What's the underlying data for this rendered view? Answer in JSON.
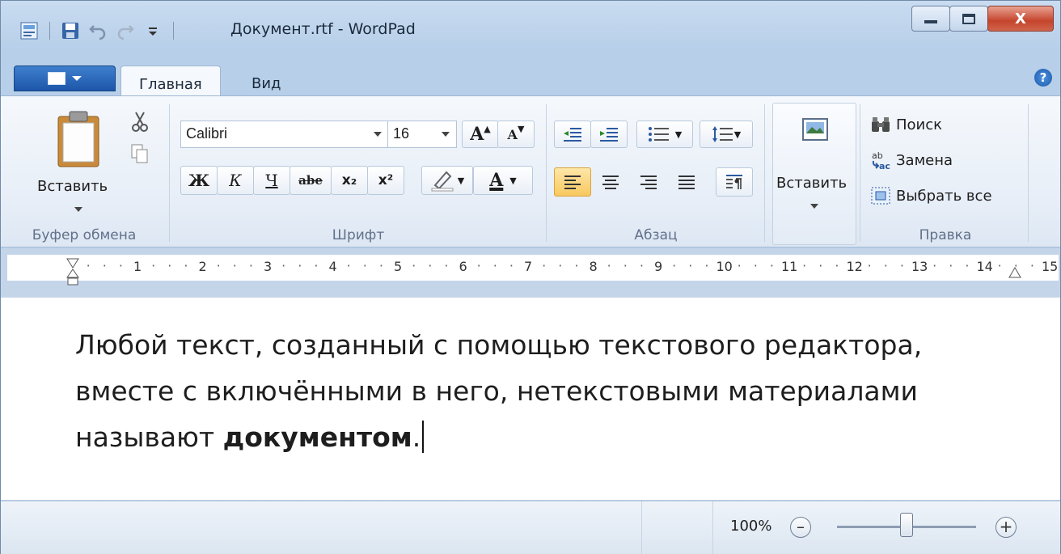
{
  "window": {
    "title": "Документ.rtf - WordPad",
    "close_glyph": "X"
  },
  "tabs": [
    {
      "label": "Главная",
      "active": true
    },
    {
      "label": "Вид",
      "active": false
    }
  ],
  "help_glyph": "?",
  "clipboard": {
    "paste_label": "Вставить",
    "group_label": "Буфер обмена"
  },
  "font": {
    "family_value": "Calibri",
    "size_value": "16",
    "bold_glyph": "Ж",
    "italic_glyph": "К",
    "underline_glyph": "Ч",
    "strike_glyph": "abe",
    "subscript_glyph": "x₂",
    "superscript_glyph": "x²",
    "grow_glyph": "A",
    "shrink_glyph": "A",
    "color_glyph": "A",
    "group_label": "Шрифт"
  },
  "paragraph": {
    "group_label": "Абзац",
    "active_alignment": "left"
  },
  "insert": {
    "label": "Вставить"
  },
  "editing": {
    "find_label": "Поиск",
    "replace_label": "Замена",
    "select_all_label": "Выбрать все",
    "group_label": "Правка"
  },
  "ruler": {
    "numbers": [
      "1",
      "2",
      "3",
      "4",
      "5",
      "6",
      "7",
      "8",
      "9",
      "10",
      "11",
      "12",
      "13",
      "14",
      "15"
    ]
  },
  "document": {
    "line1": "Любой текст, созданный с помощью текстового редактора,",
    "line2": "вместе с включёнными в него, нетекстовыми материалами",
    "line3_prefix": "называют ",
    "line3_bold": "документом",
    "line3_suffix": "."
  },
  "status": {
    "zoom_label": "100%",
    "zoom_fraction": 0.5
  },
  "colors": {
    "accent": "#1d56a8",
    "active_button": "#f8c85f",
    "close_button": "#c4442c",
    "font_color_bar": "#000000"
  }
}
